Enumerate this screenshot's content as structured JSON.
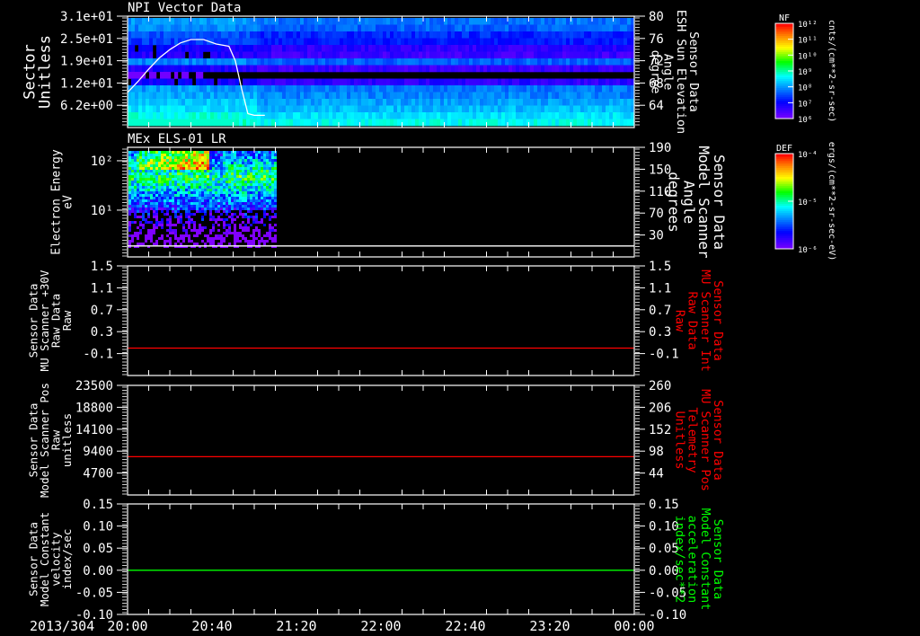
{
  "chart_data": [
    {
      "type": "heatmap",
      "title": "NPI Vector Data",
      "ylabel": [
        "Sector",
        "Unitless"
      ],
      "ylim": [
        0,
        31
      ],
      "yticks": [
        {
          "v": 31,
          "label": "3.1e+01"
        },
        {
          "v": 24.8,
          "label": "2.5e+01"
        },
        {
          "v": 18.6,
          "label": "1.9e+01"
        },
        {
          "v": 12.4,
          "label": "1.2e+01"
        },
        {
          "v": 6.2,
          "label": "6.2e+00"
        }
      ],
      "y2label": [
        "Sensor Data",
        "ESH Sun Elevation",
        "Angle",
        "degree"
      ],
      "y2lim": [
        60,
        80
      ],
      "y2ticks": [
        "80",
        "76",
        "72",
        "68",
        "64"
      ],
      "y2tick_values": [
        80,
        76,
        72,
        68,
        64
      ],
      "colorbar": {
        "label": "NF",
        "units": "cnts/(cm**2-sr-sec)",
        "ticks": [
          "10¹²",
          "10¹¹",
          "10¹⁰",
          "10⁹",
          "10⁸",
          "10⁷",
          "10⁶"
        ],
        "scale": "log"
      },
      "line_series": {
        "color": "#ffffff",
        "axis": "right",
        "x_minutes": [
          0,
          5,
          10,
          15,
          20,
          25,
          30,
          36,
          42,
          48,
          51,
          54,
          57,
          60,
          65
        ],
        "y": [
          66.3,
          68.3,
          70.5,
          72.5,
          74.0,
          75.2,
          75.8,
          75.8,
          75.0,
          74.6,
          72.0,
          67.0,
          62.5,
          62.2,
          62.2
        ]
      },
      "data_extent_minutes": [
        0,
        240
      ]
    },
    {
      "type": "heatmap",
      "title": "MEx ELS-01 LR",
      "ylabel": [
        "Electron Energy",
        "eV"
      ],
      "yscale": "log",
      "ylim": [
        1.13,
        187
      ],
      "yticks": [
        {
          "v": 100,
          "label": "10²"
        },
        {
          "v": 10,
          "label": "10¹"
        }
      ],
      "y2label": [
        "Sensor Data",
        "Model Scanner",
        "Angle",
        "degrees"
      ],
      "y2lim": [
        -10,
        190
      ],
      "y2ticks": [
        "190",
        "150",
        "110",
        "70",
        "30"
      ],
      "y2tick_values": [
        190,
        150,
        110,
        70,
        30
      ],
      "colorbar": {
        "label": "DEF",
        "units": "ergs/(cm**2-sr-sec-eV)",
        "ticks": [
          "10⁻⁴",
          "10⁻⁵",
          "10⁻⁶"
        ],
        "scale": "log"
      },
      "line_series": {
        "color": "#ffffff",
        "axis": "right",
        "x_minutes": [
          0,
          240
        ],
        "y": [
          10,
          10
        ]
      },
      "data_extent_minutes": [
        0,
        70
      ]
    },
    {
      "type": "line",
      "ylabel": [
        "Sensor Data",
        "MU Scanner +30V",
        "Raw Data",
        "Raw"
      ],
      "ylim": [
        -0.5,
        1.5
      ],
      "yticks": [
        {
          "v": 1.5,
          "label": "1.5"
        },
        {
          "v": 1.1,
          "label": "1.1"
        },
        {
          "v": 0.7,
          "label": "0.7"
        },
        {
          "v": 0.3,
          "label": "0.3"
        },
        {
          "v": -0.1,
          "label": "-0.1"
        }
      ],
      "y2label": [
        "Sensor Data",
        "MU Scanner Int",
        "Raw Data",
        "Raw"
      ],
      "y2label_color": "#ff0000",
      "y2lim": [
        -0.5,
        1.5
      ],
      "y2ticks": [
        "1.5",
        "1.1",
        "0.7",
        "0.3",
        "-0.1"
      ],
      "y2tick_values": [
        1.5,
        1.1,
        0.7,
        0.3,
        -0.1
      ],
      "series": [
        {
          "color": "#ff0000",
          "x_minutes": [
            0,
            240
          ],
          "y": [
            0.0,
            0.0
          ]
        }
      ]
    },
    {
      "type": "line",
      "ylabel": [
        "Sensor Data",
        "Model Scanner Pos",
        "Raw",
        "unitless"
      ],
      "ylim": [
        0,
        23500
      ],
      "yticks": [
        {
          "v": 23500,
          "label": "23500"
        },
        {
          "v": 18800,
          "label": "18800"
        },
        {
          "v": 14100,
          "label": "14100"
        },
        {
          "v": 9400,
          "label": "9400"
        },
        {
          "v": 4700,
          "label": "4700"
        }
      ],
      "y2label": [
        "Sensor Data",
        "MU Scanner Pos",
        "Telemetry",
        "Unitless"
      ],
      "y2label_color": "#ff0000",
      "y2lim": [
        -10,
        260
      ],
      "y2ticks": [
        "260",
        "206",
        "152",
        "98",
        "44"
      ],
      "y2tick_values": [
        260,
        206,
        152,
        98,
        44
      ],
      "series": [
        {
          "color": "#ff0000",
          "x_minutes": [
            0,
            240
          ],
          "y": [
            8200,
            8200
          ]
        }
      ]
    },
    {
      "type": "line",
      "ylabel": [
        "Sensor Data",
        "Model Constant",
        "velocity",
        "index/sec"
      ],
      "ylim": [
        -0.1,
        0.15
      ],
      "yticks": [
        {
          "v": 0.15,
          "label": "0.15"
        },
        {
          "v": 0.1,
          "label": "0.10"
        },
        {
          "v": 0.05,
          "label": "0.05"
        },
        {
          "v": 0.0,
          "label": "0.00"
        },
        {
          "v": -0.05,
          "label": "-0.05"
        },
        {
          "v": -0.1,
          "label": "-0.10"
        }
      ],
      "y2label": [
        "Sensor Data",
        "Model Constant",
        "acceleration",
        "index/sec**2"
      ],
      "y2label_color": "#00ff00",
      "y2lim": [
        -0.1,
        0.15
      ],
      "y2ticks": [
        "0.15",
        "0.10",
        "0.05",
        "0.00",
        "-0.05",
        "-0.10"
      ],
      "y2tick_values": [
        0.15,
        0.1,
        0.05,
        0.0,
        -0.05,
        -0.1
      ],
      "series": [
        {
          "color": "#00ff00",
          "x_minutes": [
            0,
            240
          ],
          "y": [
            0.0,
            0.0
          ]
        }
      ]
    }
  ],
  "time_axis": {
    "date": "2013/304",
    "labels": [
      "20:00",
      "20:40",
      "21:20",
      "22:00",
      "22:40",
      "23:20",
      "00:00"
    ],
    "range_minutes": [
      0,
      240
    ],
    "major_step_minutes": 40,
    "minor_step_minutes": 10
  },
  "colors": {
    "background": "#000000",
    "axes": "#ffffff"
  }
}
